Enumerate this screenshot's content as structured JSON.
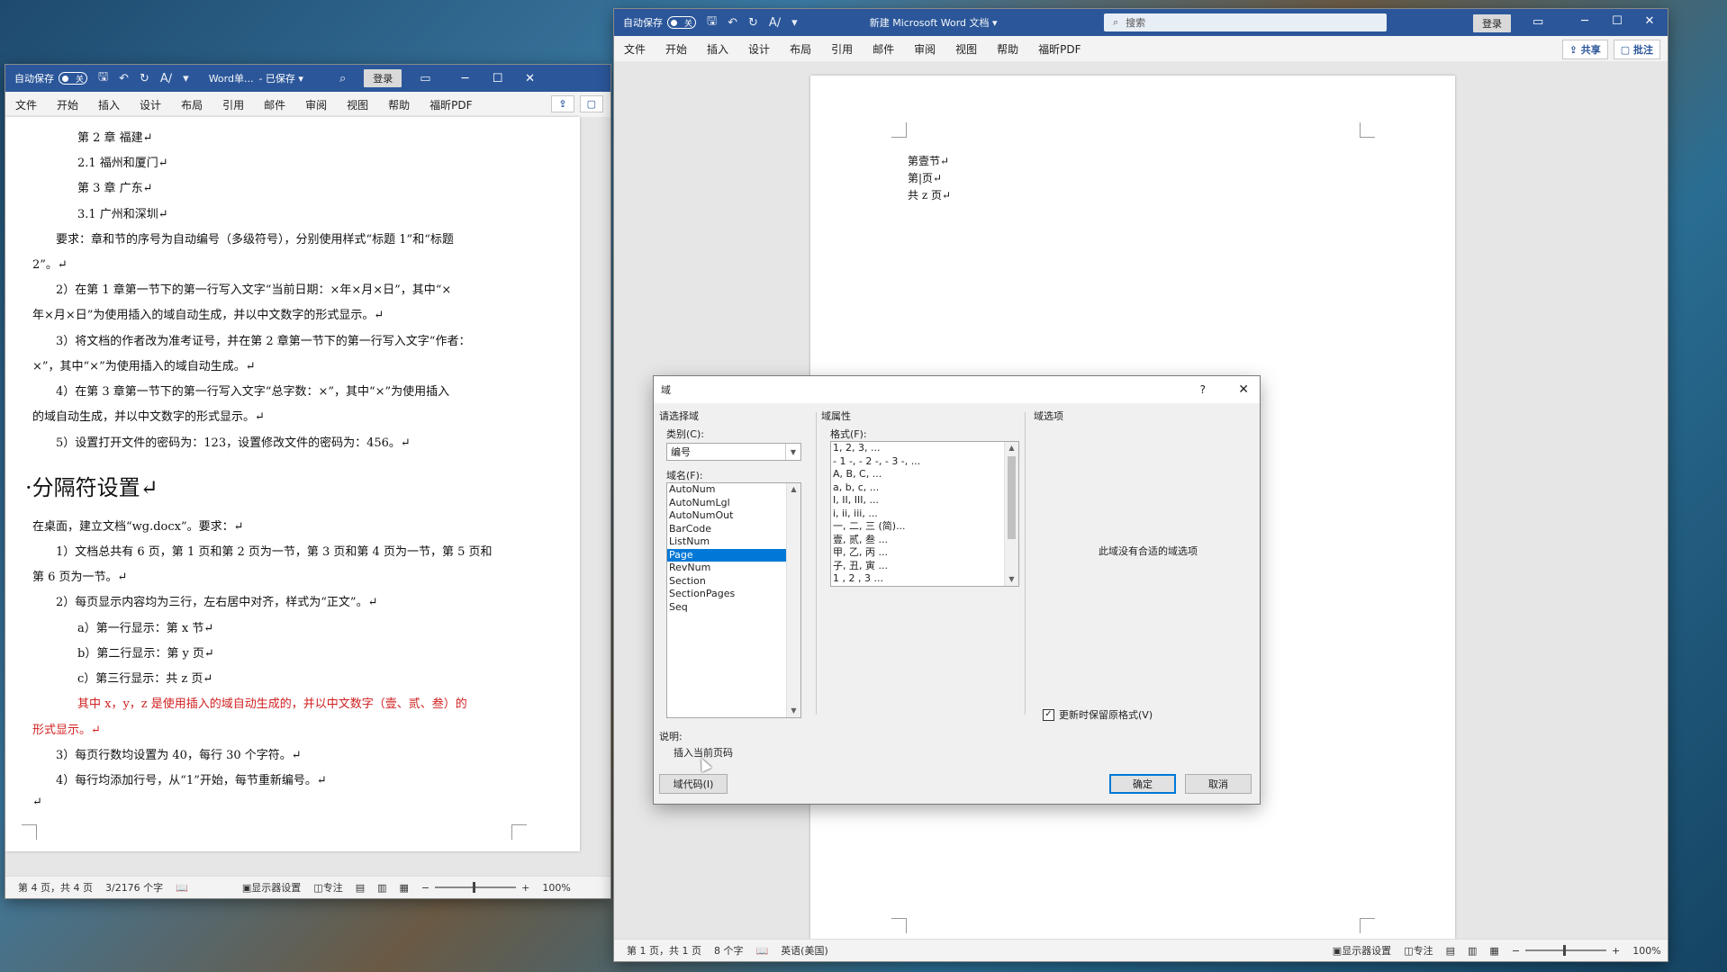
{
  "left_window": {
    "title_bar": {
      "autosave_label": "自动保存",
      "autosave_state": "关",
      "doc_name": "Word单...",
      "save_state": "- 已保存 ▾",
      "login_label": "登录"
    },
    "menu": [
      "文件",
      "开始",
      "插入",
      "设计",
      "布局",
      "引用",
      "邮件",
      "审阅",
      "视图",
      "帮助",
      "福昕PDF"
    ],
    "document": {
      "lines": [
        "第 2 章  福建↵",
        "2.1  福州和厦门↵",
        "第 3 章  广东↵",
        "3.1  广州和深圳↵",
        "要求：章和节的序号为自动编号（多级符号），分别使用样式“标题 1”和“标题",
        "2”。↵",
        "2）在第 1 章第一节下的第一行写入文字“当前日期：×年×月×日”，其中“×",
        "年×月×日”为使用插入的域自动生成，并以中文数字的形式显示。↵",
        "3）将文档的作者改为准考证号，并在第 2 章第一节下的第一行写入文字“作者：",
        "×”，其中“×”为使用插入的域自动生成。↵",
        "4）在第 3 章第一节下的第一行写入文字“总字数：×”，其中“×”为使用插入",
        "的域自动生成，并以中文数字的形式显示。↵",
        "5）设置打开文件的密码为：123，设置修改文件的密码为：456。↵"
      ],
      "heading": "·分隔符设置↵",
      "lines2": [
        "在桌面，建立文档“wg.docx”。要求：↵",
        "1）文档总共有 6 页，第 1 页和第 2 页为一节，第 3 页和第 4 页为一节，第 5 页和",
        "第 6 页为一节。↵",
        "2）每页显示内容均为三行，左右居中对齐，样式为“正文”。↵",
        "a）第一行显示：第 x 节↵",
        "b）第二行显示：第 y 页↵",
        "c）第三行显示：共 z 页↵"
      ],
      "red_lines": [
        "其中 x，y，z 是使用插入的域自动生成的，并以中文数字（壹、贰、叁）的",
        "形式显示。↵"
      ],
      "lines3": [
        "3）每页行数均设置为 40，每行 30 个字符。↵",
        "4）每行均添加行号，从“1”开始，每节重新编号。↵",
        "↵"
      ]
    },
    "status": {
      "page": "第 4 页，共 4 页",
      "words": "3/2176 个字",
      "display": "显示器设置",
      "focus": "专注",
      "zoom": "100%"
    }
  },
  "right_window": {
    "title_bar": {
      "autosave_label": "自动保存",
      "autosave_state": "关",
      "doc_name": "新建 Microsoft Word 文档 ▾",
      "search_placeholder": "搜索",
      "login_label": "登录"
    },
    "menu": [
      "文件",
      "开始",
      "插入",
      "设计",
      "布局",
      "引用",
      "邮件",
      "审阅",
      "视图",
      "帮助",
      "福昕PDF"
    ],
    "share_label": "共享",
    "comment_label": "批注",
    "document": {
      "lines": [
        "第壹节↵",
        "第|页↵",
        "共 z 页↵"
      ]
    },
    "status": {
      "page": "第 1 页，共 1 页",
      "words": "8 个字",
      "lang": "英语(美国)",
      "display": "显示器设置",
      "focus": "专注",
      "zoom": "100%"
    }
  },
  "dialog": {
    "title": "域",
    "help": "?",
    "close": "✕",
    "choose_field_label": "请选择域",
    "category_label": "类别(C):",
    "category_value": "编号",
    "field_names_label": "域名(F):",
    "field_names": [
      "AutoNum",
      "AutoNumLgl",
      "AutoNumOut",
      "BarCode",
      "ListNum",
      "Page",
      "RevNum",
      "Section",
      "SectionPages",
      "Seq"
    ],
    "selected_field": "Page",
    "field_props_label": "域属性",
    "format_label": "格式(F):",
    "formats": [
      "1, 2, 3, ...",
      "- 1 -, - 2 -, - 3 -, ...",
      "A, B, C, ...",
      "a, b, c, ...",
      "I, II, III, ...",
      "i, ii, iii, ...",
      "一, 二, 三 (简)...",
      "壹, 贰, 叁 ...",
      "甲, 乙, 丙 ...",
      "子, 丑, 寅 ...",
      "1 , 2 , 3 ..."
    ],
    "field_options_label": "域选项",
    "no_options": "此域没有合适的域选项",
    "preserve_label": "更新时保留原格式(V)",
    "desc_label": "说明:",
    "desc_text": "插入当前页码",
    "field_codes_btn": "域代码(I)",
    "ok_btn": "确定",
    "cancel_btn": "取消"
  }
}
